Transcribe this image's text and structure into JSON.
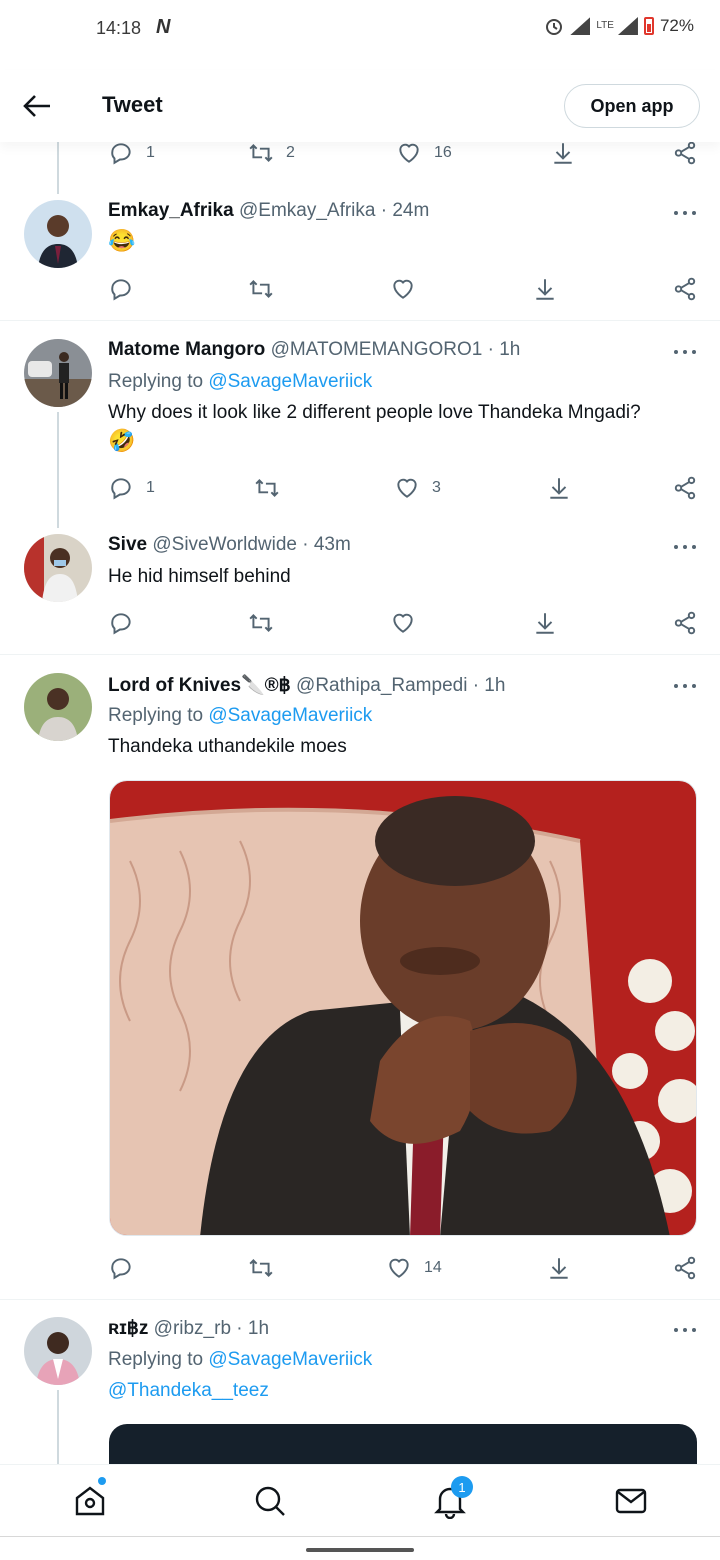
{
  "status_bar": {
    "time": "14:18",
    "network": "LTE",
    "battery": "72%"
  },
  "header": {
    "title": "Tweet",
    "open_app": "Open app"
  },
  "top_actions": {
    "replies": "1",
    "retweets": "2",
    "likes": "16"
  },
  "tweets": [
    {
      "name": "Emkay_Afrika",
      "meta": "@Emkay_Afrika · 24m",
      "text_emoji": "😂",
      "replies": "",
      "retweets": "",
      "likes": ""
    },
    {
      "name": "Matome Mangoro",
      "meta": "@MATOMEMANGORO1 · 1h",
      "replying_prefix": "Replying to ",
      "replying_handle": "@SavageMaveriick",
      "text": "Why does it look like 2 different people love Thandeka Mngadi?",
      "text_emoji": "🤣",
      "replies": "1",
      "retweets": "",
      "likes": "3"
    },
    {
      "name": "Sive",
      "meta": "@SiveWorldwide · 43m",
      "text": "He hid himself behind",
      "replies": "",
      "retweets": "",
      "likes": ""
    },
    {
      "name": "Lord of Knives🔪®฿",
      "meta": "@Rathipa_Rampedi · 1h",
      "replying_prefix": "Replying to ",
      "replying_handle": "@SavageMaveriick",
      "text": "Thandeka uthandekile moes",
      "replies": "",
      "retweets": "",
      "likes": "14"
    },
    {
      "name": "ʀɪ฿ᴢ",
      "meta": "@ribz_rb · 1h",
      "replying_prefix": "Replying to ",
      "replying_handle": "@SavageMaveriick",
      "mention": "@Thandeka__teez"
    }
  ],
  "bottom_nav": {
    "notifications_badge": "1"
  },
  "colors": {
    "accent": "#1d9bf0",
    "muted": "#536471",
    "text": "#0f1419"
  }
}
